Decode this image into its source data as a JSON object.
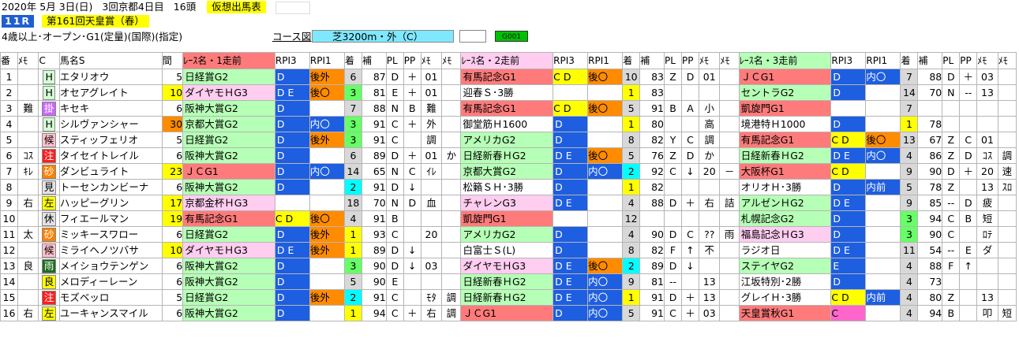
{
  "header": {
    "date": "2020年 5月 3日(日)",
    "meeting": "3回京都4日目",
    "heads": "16頭",
    "button": "仮想出馬表",
    "race_no": "11R",
    "race_name": "第161回天皇賞（春）",
    "conditions": "4歳以上･オープン･G1(定量)(国際)(指定)",
    "course_link": "コース図",
    "course": "芝3200m・外（C）",
    "code": "G001"
  },
  "columns": [
    "番",
    "ﾒﾓ",
    "C",
    "馬名S",
    "間",
    "ﾚｰｽ名・1走前",
    "RPI3",
    "RPI1",
    "着",
    "補",
    "PL",
    "PP",
    "ﾒﾓ",
    "ﾒﾓ",
    "ﾚｰｽ名・2走前",
    "RPI3",
    "RPI1",
    "着",
    "補",
    "PL",
    "PP",
    "ﾒﾓ",
    "ﾒﾓ",
    "ﾚｰｽ名・3走前",
    "RPI3",
    "RPI1",
    "着",
    "補",
    "PL",
    "PP",
    "ﾒﾓ",
    "ﾒﾓ"
  ],
  "rows": [
    {
      "num": "1",
      "memo": "",
      "mark": "H",
      "mk": "H",
      "name": "エタリオウ",
      "int": "5",
      "ic": "",
      "r1": {
        "race": "日経賞G2",
        "rc": "hp3",
        "a": "D",
        "ac": "blu",
        "b": "後外",
        "bc": "org",
        "pos": "6",
        "pc": "gry",
        "ho": "87",
        "pl": "D",
        "pp": "＋",
        "m1": "01",
        "m2": ""
      },
      "r2": {
        "race": "有馬記念G1",
        "rc": "hp1",
        "a": "C D",
        "ac": "ylw",
        "b": "後〇",
        "bc": "org",
        "pos": "10",
        "pc": "gry",
        "ho": "83",
        "pl": "Z",
        "pp": "D",
        "m1": "01",
        "m2": ""
      },
      "r3": {
        "race": "ＪＣG1",
        "rc": "hp1",
        "a": "D",
        "ac": "blu",
        "b": "内〇",
        "bc": "bd",
        "pos": "7",
        "pc": "gry",
        "ho": "88",
        "pl": "D",
        "pp": "＋",
        "m1": "03",
        "m2": ""
      }
    },
    {
      "num": "2",
      "memo": "",
      "mark": "H",
      "mk": "H",
      "name": "オセアグレイト",
      "int": "10",
      "ic": "ylw",
      "r1": {
        "race": "ダイヤモＨG3",
        "rc": "hp2",
        "a": "D E",
        "ac": "blu",
        "b": "後〇",
        "bc": "org",
        "pos": "3",
        "pc": "grn",
        "ho": "81",
        "pl": "E",
        "pp": "＋",
        "m1": "01",
        "m2": ""
      },
      "r2": {
        "race": "迎春Ｓ･3勝",
        "rc": "",
        "a": "",
        "ac": "",
        "b": "",
        "bc": "",
        "pos": "1",
        "pc": "ylw",
        "ho": "83",
        "pl": "",
        "pp": "",
        "m1": "",
        "m2": ""
      },
      "r3": {
        "race": "セントラG2",
        "rc": "hp3",
        "a": "D",
        "ac": "blu",
        "b": "",
        "bc": "",
        "pos": "14",
        "pc": "gry",
        "ho": "70",
        "pl": "N",
        "pp": "--",
        "m1": "13",
        "m2": ""
      }
    },
    {
      "num": "3",
      "memo": "難",
      "mark": "掛",
      "mk": "un",
      "name": "キセキ",
      "int": "6",
      "ic": "",
      "r1": {
        "race": "阪神大賞G2",
        "rc": "hp3",
        "a": "D",
        "ac": "blu",
        "b": "",
        "bc": "",
        "pos": "7",
        "pc": "gry",
        "ho": "88",
        "pl": "N",
        "pp": "B",
        "m1": "難",
        "m2": ""
      },
      "r2": {
        "race": "有馬記念G1",
        "rc": "hp1",
        "a": "C D",
        "ac": "ylw",
        "b": "後〇",
        "bc": "org",
        "pos": "5",
        "pc": "gry",
        "ho": "91",
        "pl": "B",
        "pp": "A",
        "m1": "小",
        "m2": ""
      },
      "r3": {
        "race": "凱旋門G1",
        "rc": "hp1",
        "a": "",
        "ac": "",
        "b": "",
        "bc": "",
        "pos": "7",
        "pc": "gry",
        "ho": "",
        "pl": "",
        "pp": "",
        "m1": "",
        "m2": ""
      }
    },
    {
      "num": "4",
      "memo": "",
      "mark": "H",
      "mk": "H",
      "name": "シルヴァンシャー",
      "int": "30",
      "ic": "org",
      "r1": {
        "race": "京都大賞G2",
        "rc": "hp3",
        "a": "D",
        "ac": "blu",
        "b": "内〇",
        "bc": "bd",
        "pos": "3",
        "pc": "grn",
        "ho": "91",
        "pl": "C",
        "pp": "＋",
        "m1": "外",
        "m2": ""
      },
      "r2": {
        "race": "御堂筋Ｈ1600",
        "rc": "",
        "a": "D",
        "ac": "blu",
        "b": "",
        "bc": "",
        "pos": "1",
        "pc": "ylw",
        "ho": "80",
        "pl": "",
        "pp": "",
        "m1": "高",
        "m2": ""
      },
      "r3": {
        "race": "境港特Ｈ1000",
        "rc": "",
        "a": "D",
        "ac": "blu",
        "b": "",
        "bc": "",
        "pos": "1",
        "pc": "ylw",
        "ho": "78",
        "pl": "",
        "pp": "",
        "m1": "",
        "m2": ""
      }
    },
    {
      "num": "5",
      "memo": "",
      "mark": "候",
      "mk": "kou",
      "name": "スティッフェリオ",
      "int": "5",
      "ic": "",
      "r1": {
        "race": "日経賞G2",
        "rc": "hp3",
        "a": "D",
        "ac": "blu",
        "b": "後外",
        "bc": "org",
        "pos": "3",
        "pc": "grn",
        "ho": "91",
        "pl": "C",
        "pp": "",
        "m1": "調",
        "m2": ""
      },
      "r2": {
        "race": "アメリカG2",
        "rc": "hp3",
        "a": "D",
        "ac": "blu",
        "b": "",
        "bc": "",
        "pos": "8",
        "pc": "gry",
        "ho": "82",
        "pl": "Y",
        "pp": "C",
        "m1": "調",
        "m2": ""
      },
      "r3": {
        "race": "有馬記念G1",
        "rc": "hp1",
        "a": "C D",
        "ac": "ylw",
        "b": "後〇",
        "bc": "org",
        "pos": "13",
        "pc": "gry",
        "ho": "67",
        "pl": "Z",
        "pp": "C",
        "m1": "01",
        "m2": ""
      }
    },
    {
      "num": "6",
      "memo": "ｺｽ",
      "mark": "注",
      "mk": "chu",
      "name": "タイセイトレイル",
      "int": "6",
      "ic": "",
      "r1": {
        "race": "阪神大賞G2",
        "rc": "hp3",
        "a": "D",
        "ac": "blu",
        "b": "",
        "bc": "",
        "pos": "6",
        "pc": "gry",
        "ho": "89",
        "pl": "D",
        "pp": "＋",
        "m1": "01",
        "m2": "か"
      },
      "r2": {
        "race": "日経新春ＨG2",
        "rc": "hp3",
        "a": "D E",
        "ac": "blu",
        "b": "後〇",
        "bc": "org",
        "pos": "5",
        "pc": "gry",
        "ho": "76",
        "pl": "Z",
        "pp": "D",
        "m1": "か",
        "m2": ""
      },
      "r3": {
        "race": "日経新春ＨG2",
        "rc": "hp3",
        "a": "D E",
        "ac": "blu",
        "b": "内〇",
        "bc": "bd",
        "pos": "4",
        "pc": "gry",
        "ho": "86",
        "pl": "Z",
        "pp": "D",
        "m1": "ｺｽ",
        "m2": "調"
      }
    },
    {
      "num": "7",
      "memo": "ｷﾚ",
      "mark": "砂",
      "mk": "sho",
      "name": "ダンビュライト",
      "int": "23",
      "ic": "ylw",
      "r1": {
        "race": "ＪＣG1",
        "rc": "hp1",
        "a": "D",
        "ac": "blu",
        "b": "内〇",
        "bc": "bd",
        "pos": "14",
        "pc": "gry",
        "ho": "65",
        "pl": "N",
        "pp": "C",
        "m1": "ｲﾚ",
        "m2": ""
      },
      "r2": {
        "race": "京都大賞G2",
        "rc": "hp3",
        "a": "D",
        "ac": "blu",
        "b": "内〇",
        "bc": "bd",
        "pos": "2",
        "pc": "cy",
        "ho": "92",
        "pl": "C",
        "pp": "↓",
        "m1": "20",
        "m2": "－"
      },
      "r3": {
        "race": "大阪杯G1",
        "rc": "hp1",
        "a": "C D",
        "ac": "ylw",
        "b": "",
        "bc": "",
        "pos": "9",
        "pc": "gry",
        "ho": "90",
        "pl": "D",
        "pp": "＋",
        "m1": "20",
        "m2": "速"
      }
    },
    {
      "num": "8",
      "memo": "",
      "mark": "見",
      "mk": "mi",
      "name": "トーセンカンビーナ",
      "int": "6",
      "ic": "",
      "r1": {
        "race": "阪神大賞G2",
        "rc": "hp3",
        "a": "D",
        "ac": "blu",
        "b": "",
        "bc": "",
        "pos": "2",
        "pc": "cy",
        "ho": "91",
        "pl": "D",
        "pp": "↓",
        "m1": "",
        "m2": ""
      },
      "r2": {
        "race": "松籟ＳＨ･3勝",
        "rc": "",
        "a": "D",
        "ac": "blu",
        "b": "",
        "bc": "",
        "pos": "1",
        "pc": "ylw",
        "ho": "82",
        "pl": "",
        "pp": "",
        "m1": "",
        "m2": ""
      },
      "r3": {
        "race": "オリオＨ･3勝",
        "rc": "",
        "a": "D",
        "ac": "blu",
        "b": "内前",
        "bc": "bd",
        "pos": "5",
        "pc": "gry",
        "ho": "78",
        "pl": "Z",
        "pp": "",
        "m1": "13",
        "m2": "ｽﾛ"
      }
    },
    {
      "num": "9",
      "memo": "右",
      "mark": "左",
      "mk": "sa",
      "name": "ハッピーグリン",
      "int": "17",
      "ic": "ylw",
      "r1": {
        "race": "京都金杯ＨG3",
        "rc": "hp2",
        "a": "",
        "ac": "",
        "b": "",
        "bc": "",
        "pos": "18",
        "pc": "gry",
        "ho": "70",
        "pl": "N",
        "pp": "D",
        "m1": "血",
        "m2": ""
      },
      "r2": {
        "race": "チャレンG3",
        "rc": "hp2",
        "a": "D E",
        "ac": "blu",
        "b": "",
        "bc": "",
        "pos": "4",
        "pc": "gry",
        "ho": "88",
        "pl": "D",
        "pp": "＋",
        "m1": "右",
        "m2": "詰"
      },
      "r3": {
        "race": "アルゼンＨG2",
        "rc": "hp3",
        "a": "D E",
        "ac": "blu",
        "b": "",
        "bc": "",
        "pos": "9",
        "pc": "gry",
        "ho": "85",
        "pl": "--",
        "pp": "D",
        "m1": "疲",
        "m2": ""
      }
    },
    {
      "num": "10",
      "memo": "",
      "mark": "休",
      "mk": "kyu",
      "name": "フィエールマン",
      "int": "19",
      "ic": "ylw",
      "r1": {
        "race": "有馬記念G1",
        "rc": "hp1",
        "a": "C D",
        "ac": "ylw",
        "b": "後〇",
        "bc": "org",
        "pos": "4",
        "pc": "gry",
        "ho": "91",
        "pl": "B",
        "pp": "",
        "m1": "",
        "m2": ""
      },
      "r2": {
        "race": "凱旋門G1",
        "rc": "hp1",
        "a": "",
        "ac": "",
        "b": "",
        "bc": "",
        "pos": "12",
        "pc": "gry",
        "ho": "",
        "pl": "",
        "pp": "",
        "m1": "",
        "m2": ""
      },
      "r3": {
        "race": "札幌記念G2",
        "rc": "hp3",
        "a": "D",
        "ac": "blu",
        "b": "",
        "bc": "",
        "pos": "3",
        "pc": "grn",
        "ho": "94",
        "pl": "C",
        "pp": "B",
        "m1": "短",
        "m2": ""
      }
    },
    {
      "num": "11",
      "memo": "太",
      "mark": "砂",
      "mk": "sho",
      "name": "ミッキースワロー",
      "int": "6",
      "ic": "",
      "r1": {
        "race": "日経賞G2",
        "rc": "hp3",
        "a": "D",
        "ac": "blu",
        "b": "後外",
        "bc": "org",
        "pos": "1",
        "pc": "ylw",
        "ho": "93",
        "pl": "C",
        "pp": "",
        "m1": "20",
        "m2": ""
      },
      "r2": {
        "race": "アメリカG2",
        "rc": "hp3",
        "a": "D",
        "ac": "blu",
        "b": "",
        "bc": "",
        "pos": "4",
        "pc": "gry",
        "ho": "90",
        "pl": "D",
        "pp": "C",
        "m1": "??",
        "m2": "雨"
      },
      "r3": {
        "race": "福島記念ＨG3",
        "rc": "hp2",
        "a": "D",
        "ac": "blu",
        "b": "",
        "bc": "",
        "pos": "3",
        "pc": "grn",
        "ho": "90",
        "pl": "C",
        "pp": "",
        "m1": "ﾛﾃ",
        "m2": ""
      }
    },
    {
      "num": "12",
      "memo": "",
      "mark": "候",
      "mk": "kou",
      "name": "ミライヘノツバサ",
      "int": "10",
      "ic": "ylw",
      "r1": {
        "race": "ダイヤモＨG3",
        "rc": "hp2",
        "a": "D E",
        "ac": "blu",
        "b": "後外",
        "bc": "org",
        "pos": "1",
        "pc": "ylw",
        "ho": "89",
        "pl": "D",
        "pp": "↓",
        "m1": "",
        "m2": ""
      },
      "r2": {
        "race": "白富士Ｓ(L)",
        "rc": "",
        "a": "D",
        "ac": "blu",
        "b": "",
        "bc": "",
        "pos": "8",
        "pc": "gry",
        "ho": "82",
        "pl": "F",
        "pp": "↑",
        "m1": "不",
        "m2": ""
      },
      "r3": {
        "race": "ラジオ日",
        "rc": "",
        "a": "D E",
        "ac": "blu",
        "b": "",
        "bc": "",
        "pos": "11",
        "pc": "gry",
        "ho": "54",
        "pl": "--",
        "pp": "E",
        "m1": "ダ",
        "m2": ""
      }
    },
    {
      "num": "13",
      "memo": "良",
      "mark": "雨",
      "mk": "ame",
      "name": "メイショウテンゲン",
      "int": "6",
      "ic": "",
      "r1": {
        "race": "阪神大賞G2",
        "rc": "hp3",
        "a": "D",
        "ac": "blu",
        "b": "",
        "bc": "",
        "pos": "3",
        "pc": "grn",
        "ho": "90",
        "pl": "D",
        "pp": "↓",
        "m1": "03",
        "m2": ""
      },
      "r2": {
        "race": "ダイヤモＨG3",
        "rc": "hp2",
        "a": "D E",
        "ac": "blu",
        "b": "後〇",
        "bc": "org",
        "pos": "2",
        "pc": "cy",
        "ho": "89",
        "pl": "D",
        "pp": "↓",
        "m1": "",
        "m2": ""
      },
      "r3": {
        "race": "ステイヤG2",
        "rc": "hp3",
        "a": "E",
        "ac": "blu",
        "b": "",
        "bc": "",
        "pos": "4",
        "pc": "gry",
        "ho": "88",
        "pl": "F",
        "pp": "↑",
        "m1": "",
        "m2": ""
      }
    },
    {
      "num": "14",
      "memo": "",
      "mark": "良",
      "mk": "ryo",
      "name": "メロディーレーン",
      "int": "6",
      "ic": "",
      "r1": {
        "race": "阪神大賞G2",
        "rc": "hp3",
        "a": "D",
        "ac": "blu",
        "b": "",
        "bc": "",
        "pos": "5",
        "pc": "gry",
        "ho": "90",
        "pl": "E",
        "pp": "",
        "m1": "",
        "m2": ""
      },
      "r2": {
        "race": "日経新春ＨG2",
        "rc": "hp3",
        "a": "D E",
        "ac": "blu",
        "b": "内〇",
        "bc": "bd",
        "pos": "9",
        "pc": "gry",
        "ho": "81",
        "pl": "--",
        "pp": "",
        "m1": "13",
        "m2": ""
      },
      "r3": {
        "race": "江坂特別･2勝",
        "rc": "",
        "a": "D",
        "ac": "blu",
        "b": "",
        "bc": "",
        "pos": "4",
        "pc": "gry",
        "ho": "73",
        "pl": "",
        "pp": "",
        "m1": "",
        "m2": ""
      }
    },
    {
      "num": "15",
      "memo": "",
      "mark": "注",
      "mk": "chu",
      "name": "モズベッロ",
      "int": "5",
      "ic": "",
      "r1": {
        "race": "日経賞G2",
        "rc": "hp3",
        "a": "D",
        "ac": "blu",
        "b": "後外",
        "bc": "org",
        "pos": "2",
        "pc": "cy",
        "ho": "91",
        "pl": "C",
        "pp": "",
        "m1": "ﾓﾀ",
        "m2": "調"
      },
      "r2": {
        "race": "日経新春ＨG2",
        "rc": "hp3",
        "a": "D E",
        "ac": "blu",
        "b": "内〇",
        "bc": "bd",
        "pos": "1",
        "pc": "ylw",
        "ho": "91",
        "pl": "D",
        "pp": "＋",
        "m1": "13",
        "m2": ""
      },
      "r3": {
        "race": "グレイＨ･3勝",
        "rc": "",
        "a": "C D",
        "ac": "ylw",
        "b": "内前",
        "bc": "bd",
        "pos": "4",
        "pc": "gry",
        "ho": "80",
        "pl": "Z",
        "pp": "",
        "m1": "13",
        "m2": ""
      }
    },
    {
      "num": "16",
      "memo": "右",
      "mark": "左",
      "mk": "sa",
      "name": "ユーキャンスマイル",
      "int": "6",
      "ic": "",
      "r1": {
        "race": "阪神大賞G2",
        "rc": "hp3",
        "a": "D",
        "ac": "blu",
        "b": "",
        "bc": "",
        "pos": "1",
        "pc": "ylw",
        "ho": "94",
        "pl": "C",
        "pp": "＋",
        "m1": "右",
        "m2": "調"
      },
      "r2": {
        "race": "ＪＣG1",
        "rc": "hp1",
        "a": "D",
        "ac": "blu",
        "b": "内〇",
        "bc": "bd",
        "pos": "5",
        "pc": "gry",
        "ho": "91",
        "pl": "C",
        "pp": "＋",
        "m1": "03",
        "m2": ""
      },
      "r3": {
        "race": "天皇賞秋G1",
        "rc": "hp1",
        "a": "C",
        "ac": "pnk",
        "b": "",
        "bc": "",
        "pos": "4",
        "pc": "gry",
        "ho": "94",
        "pl": "B",
        "pp": "",
        "m1": "叩",
        "m2": "短"
      }
    }
  ]
}
